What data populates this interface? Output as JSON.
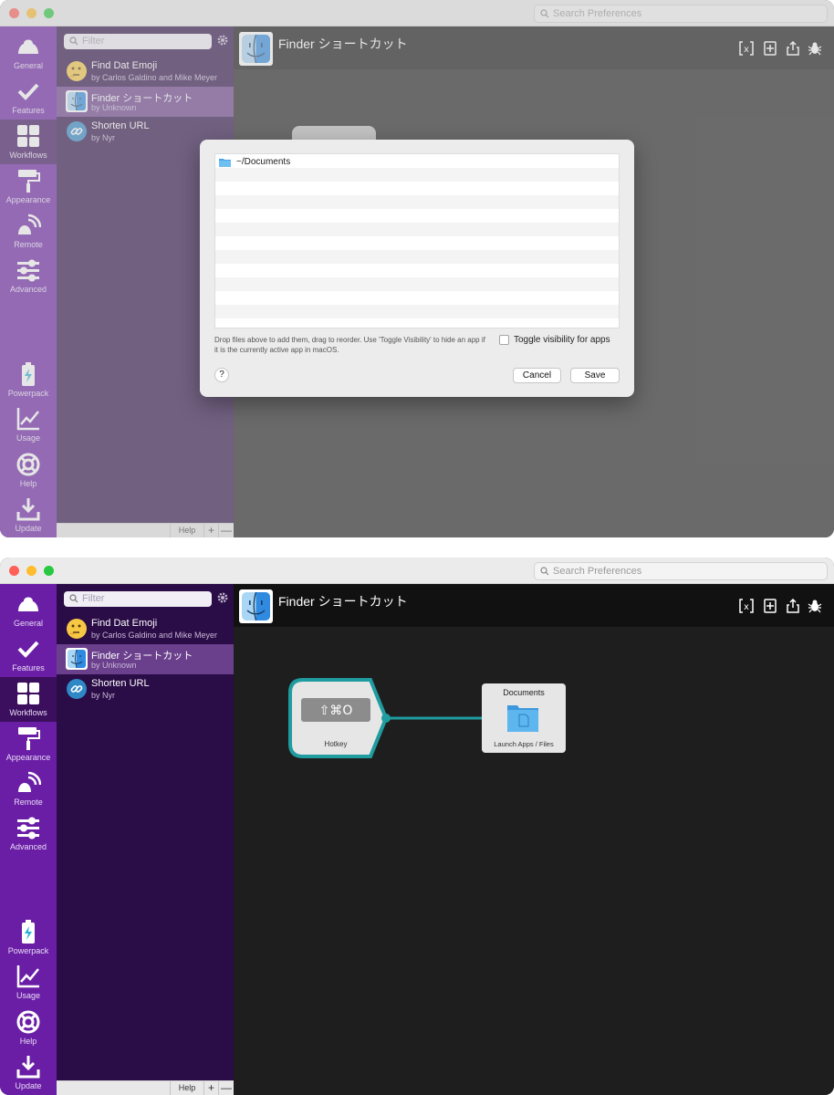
{
  "window": {
    "search_placeholder": "Search Preferences"
  },
  "nav": {
    "items": [
      {
        "label": "General",
        "icon": "general-icon"
      },
      {
        "label": "Features",
        "icon": "checkmark-icon"
      },
      {
        "label": "Workflows",
        "icon": "workflows-grid-icon",
        "active": true
      },
      {
        "label": "Appearance",
        "icon": "paint-roller-icon"
      },
      {
        "label": "Remote",
        "icon": "remote-icon"
      },
      {
        "label": "Advanced",
        "icon": "sliders-icon"
      },
      {
        "label": "Powerpack",
        "icon": "battery-bolt-icon"
      },
      {
        "label": "Usage",
        "icon": "line-chart-icon"
      },
      {
        "label": "Help",
        "icon": "lifebuoy-icon"
      },
      {
        "label": "Update",
        "icon": "download-icon"
      }
    ]
  },
  "list": {
    "filter_placeholder": "Filter",
    "workflows": [
      {
        "name": "Find Dat Emoji",
        "author": "by Carlos Galdino and Mike Meyer",
        "icon": "thinking-emoji-icon"
      },
      {
        "name": "Finder ショートカット",
        "author": "by Unknown",
        "icon": "finder-icon",
        "selected": true
      },
      {
        "name": "Shorten URL",
        "author": "by Nyr",
        "icon": "link-icon"
      }
    ],
    "bottom": {
      "help": "Help",
      "plus": "+",
      "minus": "—"
    }
  },
  "header": {
    "title": "Finder ショートカット"
  },
  "sheet": {
    "files": [
      "~/Documents"
    ],
    "note": "Drop files above to add them, drag to reorder. Use 'Toggle Visibility' to hide an app if it is the currently active app in macOS.",
    "toggle_label": "Toggle visibility for apps",
    "toggle_checked": false,
    "help": "?",
    "cancel": "Cancel",
    "save": "Save"
  },
  "canvas": {
    "hotkey": {
      "keys": "⇧⌘O",
      "label": "Hotkey"
    },
    "action": {
      "title": "Documents",
      "label": "Launch Apps / Files"
    }
  },
  "colors": {
    "sidebar": "#6a1ea6",
    "sidebar_active": "#3b0e5e",
    "list_bg": "#2a0c46",
    "accent_teal": "#1f9ca0"
  }
}
